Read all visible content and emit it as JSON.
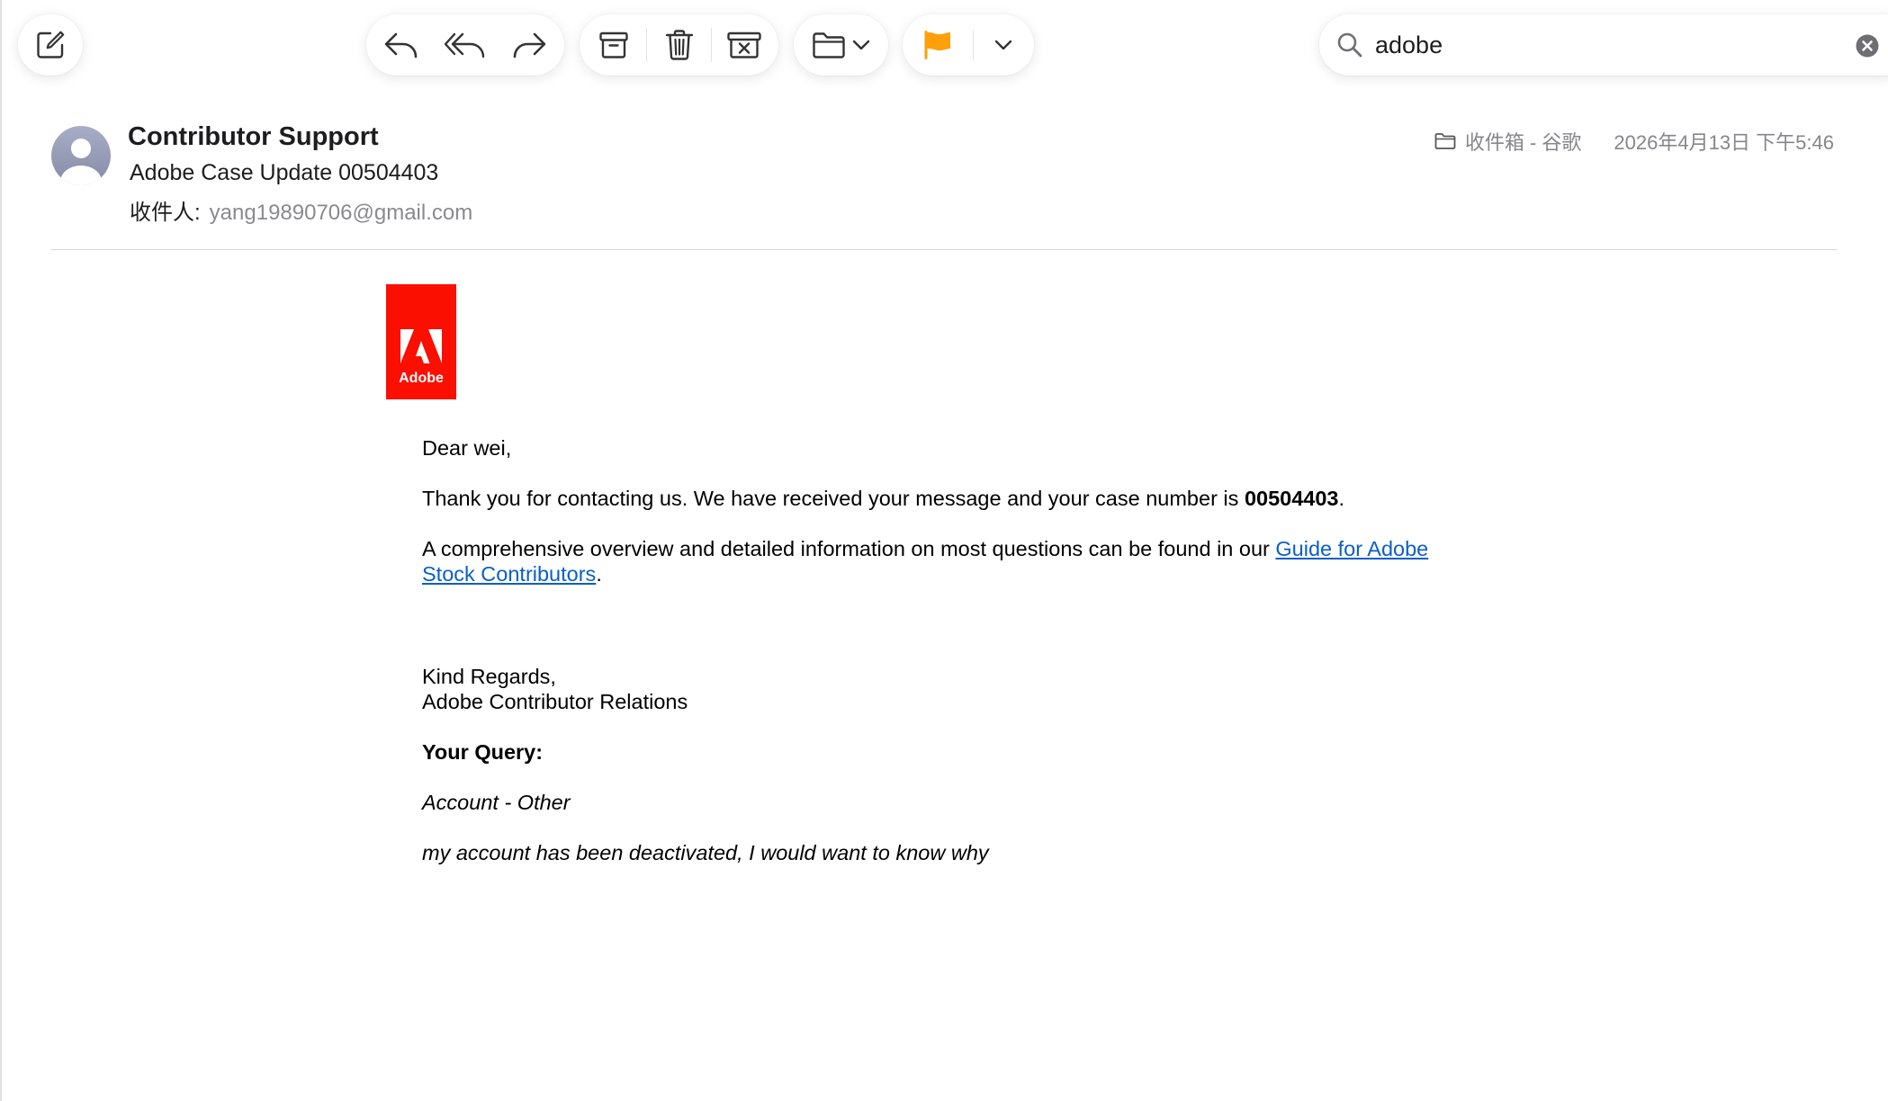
{
  "toolbar": {
    "compose": "compose",
    "buttons": [
      "reply",
      "reply-all",
      "forward",
      "archive",
      "trash",
      "junk",
      "move-to-folder",
      "flag",
      "more"
    ],
    "flag_color": "#ff9f0a"
  },
  "search": {
    "value": "adobe"
  },
  "message": {
    "sender": "Contributor Support",
    "subject": "Adobe Case Update 00504403",
    "to_label": "收件人:",
    "to_address": "yang19890706@gmail.com",
    "mailbox": "收件箱 - 谷歌",
    "date": "2026年4月13日 下午5:46"
  },
  "email": {
    "logo_text": "Adobe",
    "brand_color": "#fa0f00",
    "greeting": "Dear wei,",
    "thanks_text": "Thank you for contacting us. We have received your message and your case number is ",
    "case_number": "00504403",
    "thanks_end": ".",
    "overview_text": "A comprehensive overview and detailed information on most questions can be found in our ",
    "guide_link": "Guide for Adobe Stock Contributors",
    "overview_end": ".",
    "regards": "Kind Regards,",
    "team": "Adobe Contributor Relations",
    "query_heading": "Your Query:",
    "query_category": "Account - Other",
    "query_text": "my account has been deactivated, I would want to know why"
  }
}
